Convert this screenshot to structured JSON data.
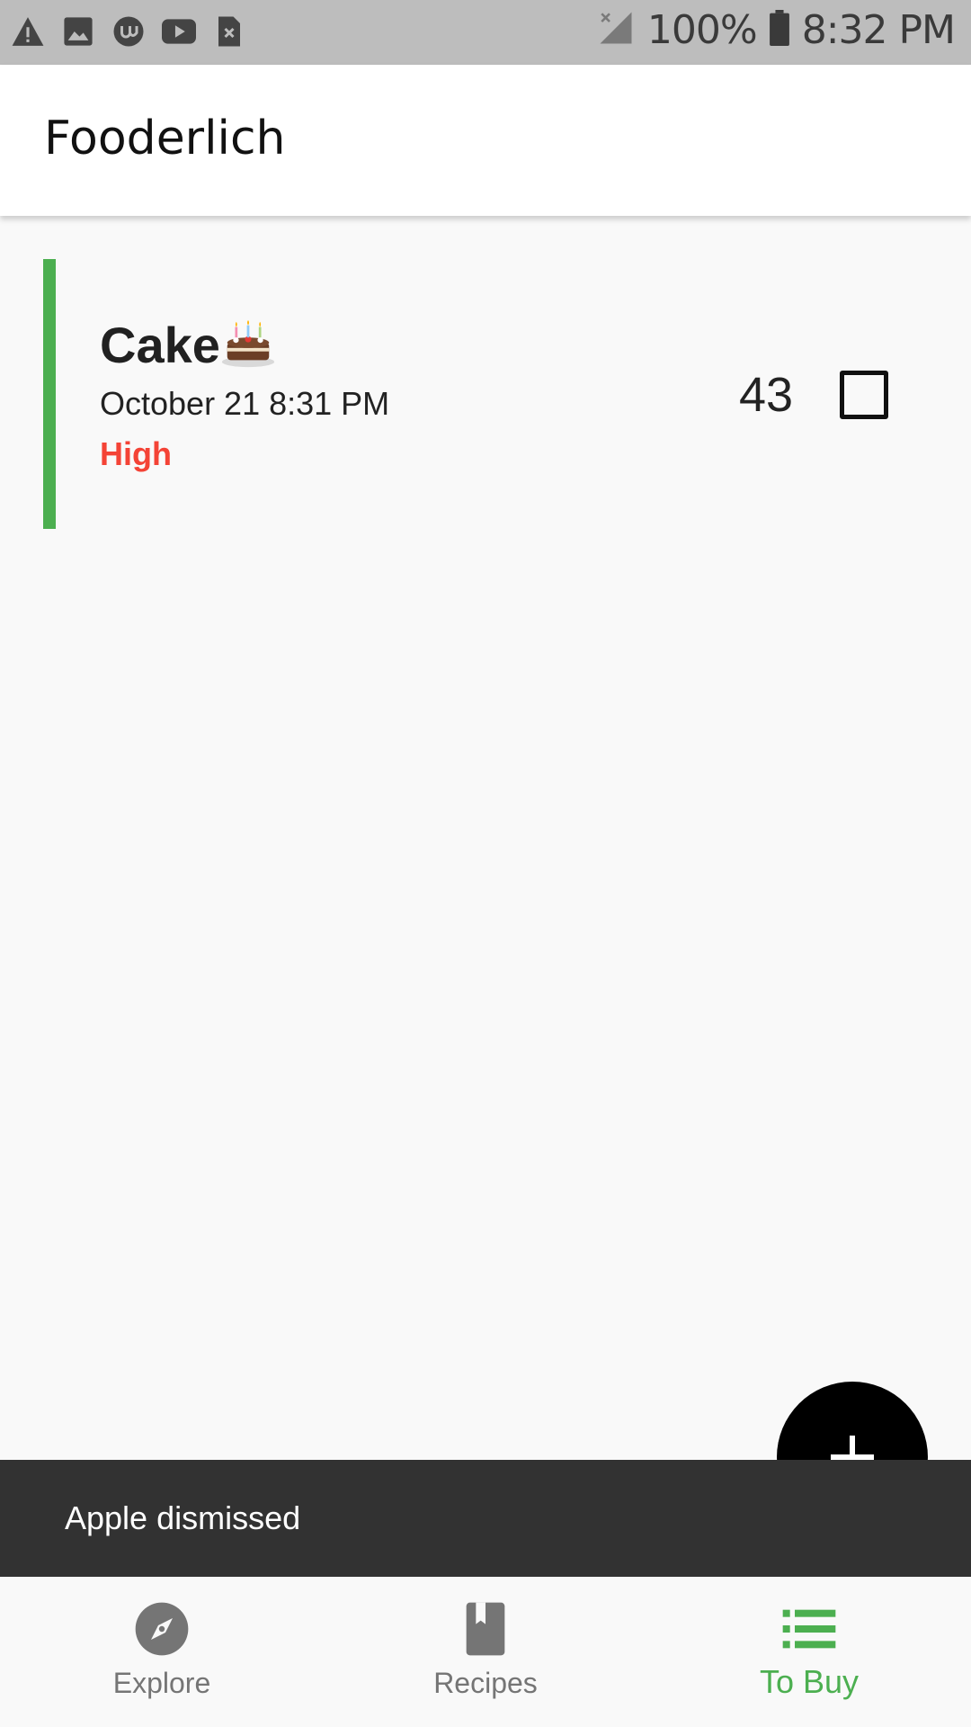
{
  "status_bar": {
    "icons_left": [
      "warning-icon",
      "image-icon",
      "upwork-icon",
      "youtube-icon",
      "sim-error-icon"
    ],
    "battery": "100%",
    "time": "8:32 PM"
  },
  "app_bar": {
    "title": "Fooderlich"
  },
  "grocery_items": [
    {
      "name": "Cake",
      "emoji": "🎂",
      "date": "October 21 8:31 PM",
      "importance": "High",
      "quantity": "43",
      "checked": false,
      "color": "#4caf50"
    }
  ],
  "fab": {
    "icon": "plus-icon"
  },
  "snackbar": {
    "message": "Apple dismissed"
  },
  "bottom_nav": {
    "items": [
      {
        "label": "Explore",
        "icon": "explore-icon",
        "active": false
      },
      {
        "label": "Recipes",
        "icon": "book-icon",
        "active": false
      },
      {
        "label": "To Buy",
        "icon": "list-icon",
        "active": true
      }
    ]
  },
  "colors": {
    "accent": "#4caf50",
    "importance_high": "#f44336",
    "snackbar_bg": "#323232"
  }
}
